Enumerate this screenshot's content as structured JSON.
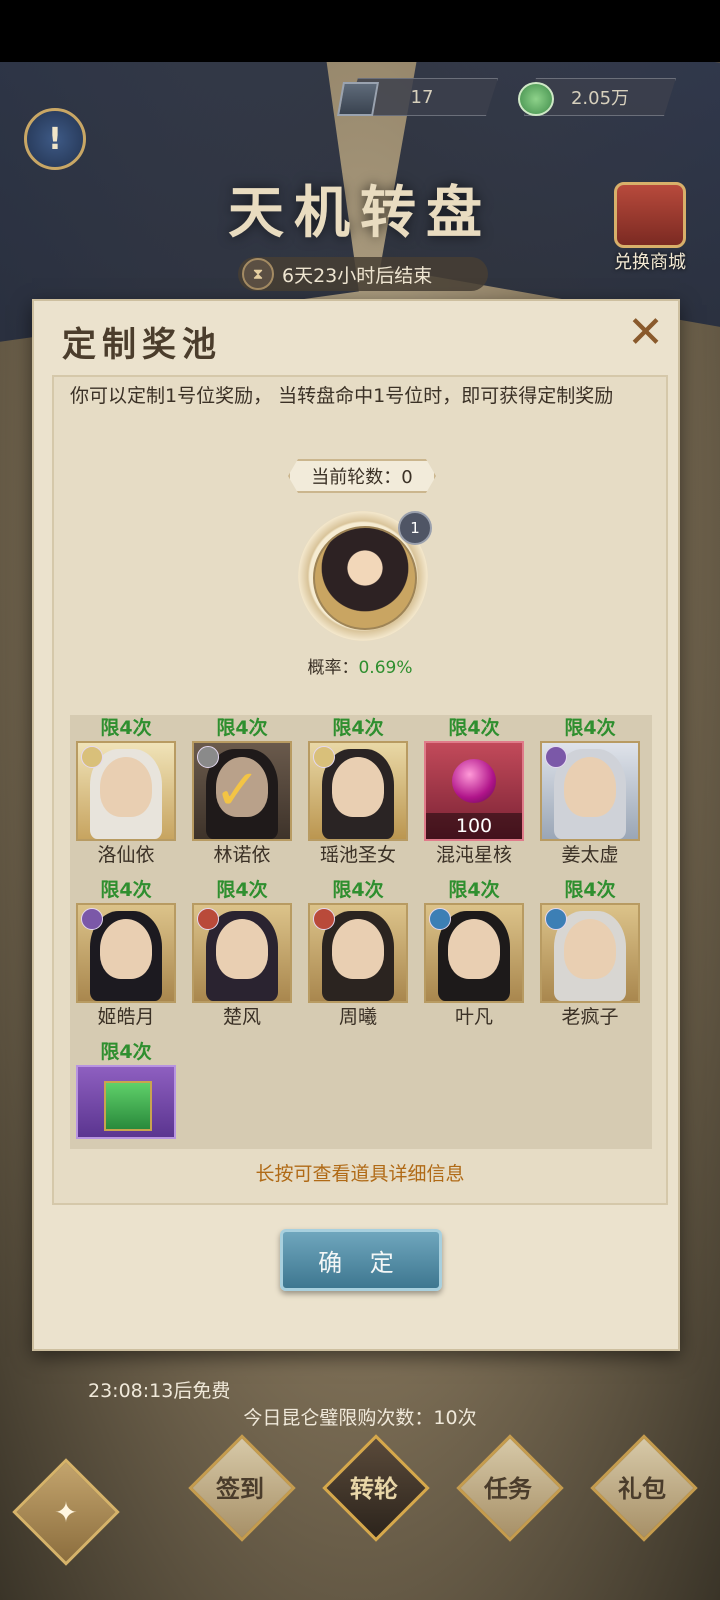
{
  "resources": [
    {
      "icon": "book-icon",
      "value": "17"
    },
    {
      "icon": "jade-coin-icon",
      "value": "2.05万"
    }
  ],
  "event": {
    "title": "天机转盘",
    "timer": "6天23小时后结束"
  },
  "shop": {
    "label": "兑换商城"
  },
  "dialog": {
    "title": "定制奖池",
    "description": "你可以定制1号位奖励， 当转盘命中1号位时，即可获得定制奖励",
    "round_label": "当前轮数：0",
    "slot_badge": "1",
    "rate_label": "概率：",
    "rate_value": "0.69%",
    "hint": "长按可查看道具详细信息",
    "confirm": "确 定"
  },
  "rewards": [
    {
      "limit": "限4次",
      "name": "洛仙依",
      "selected": false
    },
    {
      "limit": "限4次",
      "name": "林诺依",
      "selected": true
    },
    {
      "limit": "限4次",
      "name": "瑶池圣女",
      "selected": false
    },
    {
      "limit": "限4次",
      "name": "混沌星核",
      "count": "100",
      "selected": false
    },
    {
      "limit": "限4次",
      "name": "姜太虚",
      "selected": false
    },
    {
      "limit": "限4次",
      "name": "姬皓月",
      "selected": false
    },
    {
      "limit": "限4次",
      "name": "楚风",
      "selected": false
    },
    {
      "limit": "限4次",
      "name": "周曦",
      "selected": false
    },
    {
      "limit": "限4次",
      "name": "叶凡",
      "selected": false
    },
    {
      "limit": "限4次",
      "name": "老疯子",
      "selected": false
    },
    {
      "limit": "限4次",
      "name": "",
      "selected": false
    }
  ],
  "footer": {
    "free_timer": "23:08:13后免费",
    "purchase_limit": "今日昆仑璧限购次数：10次"
  },
  "nav": [
    {
      "label": "签到"
    },
    {
      "label": "转轮"
    },
    {
      "label": "任务"
    },
    {
      "label": "礼包"
    }
  ]
}
